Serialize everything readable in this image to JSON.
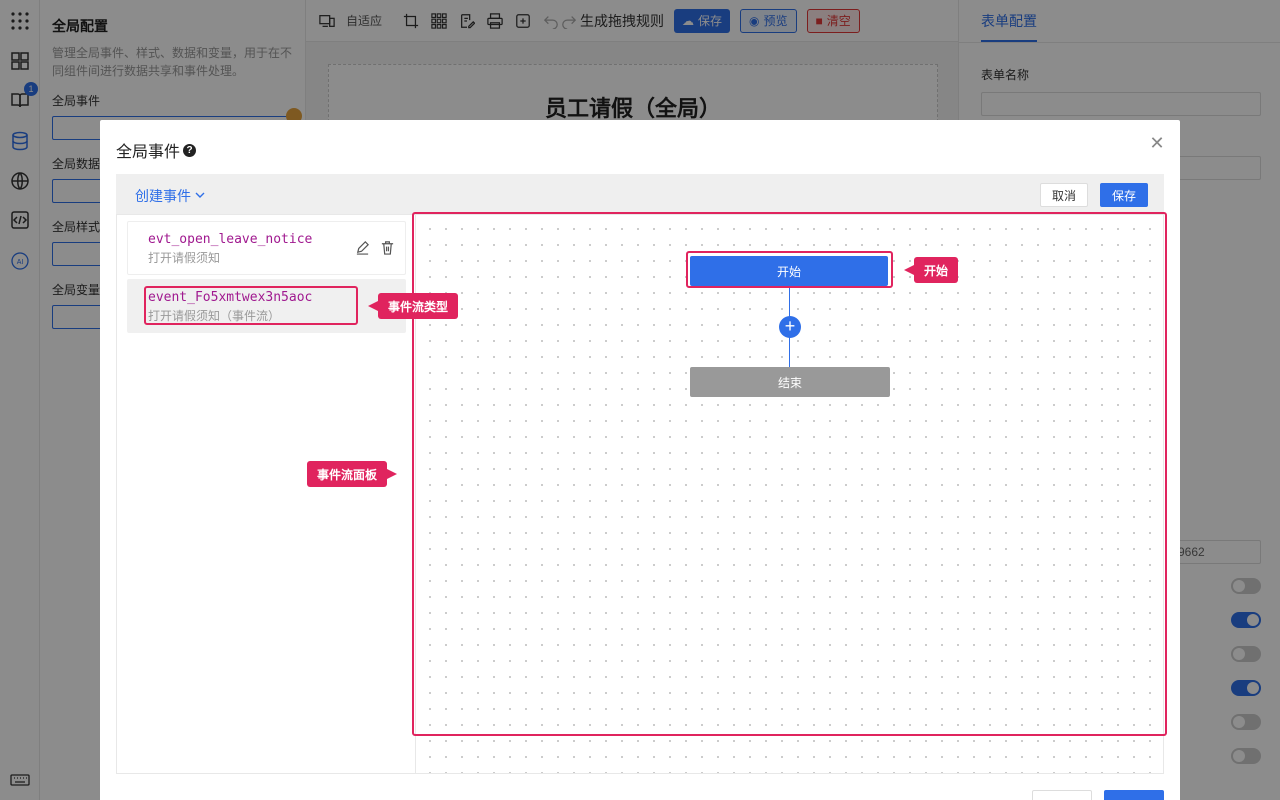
{
  "app": {
    "left_panel": {
      "title": "全局配置",
      "description": "管理全局事件、样式、数据和变量，用于在不同组件间进行数据共享和事件处理。",
      "sections": [
        "全局事件",
        "全局数据",
        "全局样式",
        "全局变量"
      ],
      "badge_count": "1"
    },
    "toolbar": {
      "layout_select": "自适应",
      "generate_rules": "生成拖拽规则",
      "save_label": "保存",
      "preview_label": "预览",
      "clear_label": "清空"
    },
    "canvas": {
      "form_title": "员工请假（全局）"
    },
    "right_panel": {
      "tab": "表单配置",
      "form_name_label": "表单名称",
      "partial_value": "9662"
    }
  },
  "modal": {
    "title": "全局事件",
    "create_label": "创建事件",
    "cancel_label": "取消",
    "save_label": "保存",
    "events": [
      {
        "code": "evt_open_leave_notice",
        "desc": "打开请假须知"
      },
      {
        "code": "event_Fo5xmtwex3n5aoc",
        "desc": "打开请假须知（事件流）"
      }
    ],
    "flow": {
      "start_label": "开始",
      "end_label": "结束"
    }
  },
  "annotations": {
    "event_flow_type": "事件流类型",
    "start": "开始",
    "flow_panel": "事件流面板"
  },
  "colors": {
    "primary": "#2f6fe8",
    "annotation": "#e0245e",
    "event_code": "#a0198f"
  }
}
